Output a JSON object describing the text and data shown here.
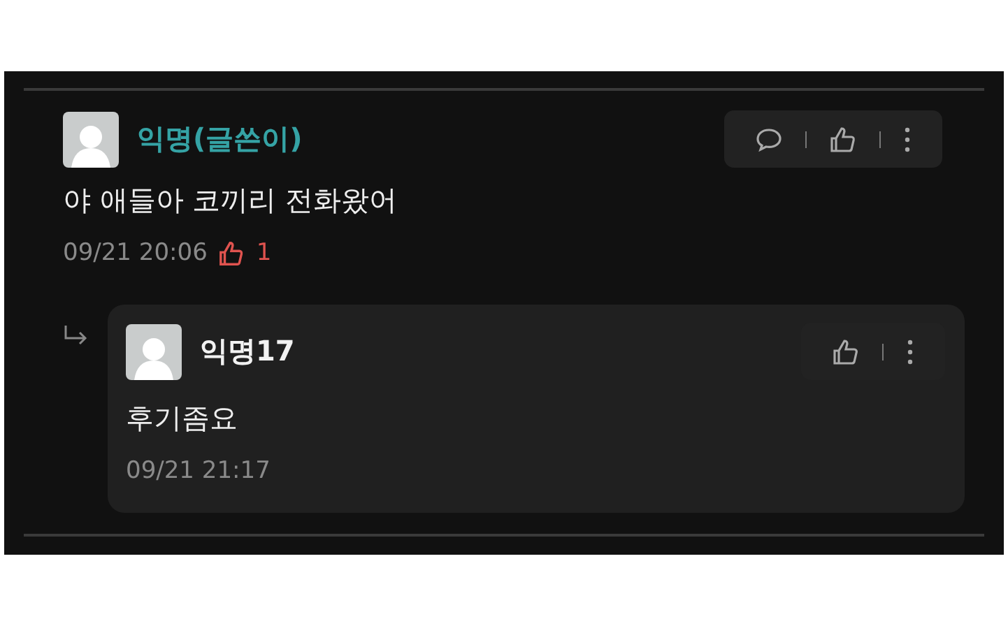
{
  "comment": {
    "author": "익명(글쓴이)",
    "is_author": true,
    "text": "야 애들아 코끼리 전화왔어",
    "time": "09/21 20:06",
    "likes": "1",
    "actions": [
      {
        "kind": "comment"
      },
      {
        "kind": "like"
      },
      {
        "kind": "more"
      }
    ]
  },
  "replies": [
    {
      "author": "익명17",
      "is_author": false,
      "text": "후기좀요",
      "time": "09/21 21:17",
      "actions": [
        {
          "kind": "like"
        },
        {
          "kind": "more"
        }
      ]
    }
  ]
}
